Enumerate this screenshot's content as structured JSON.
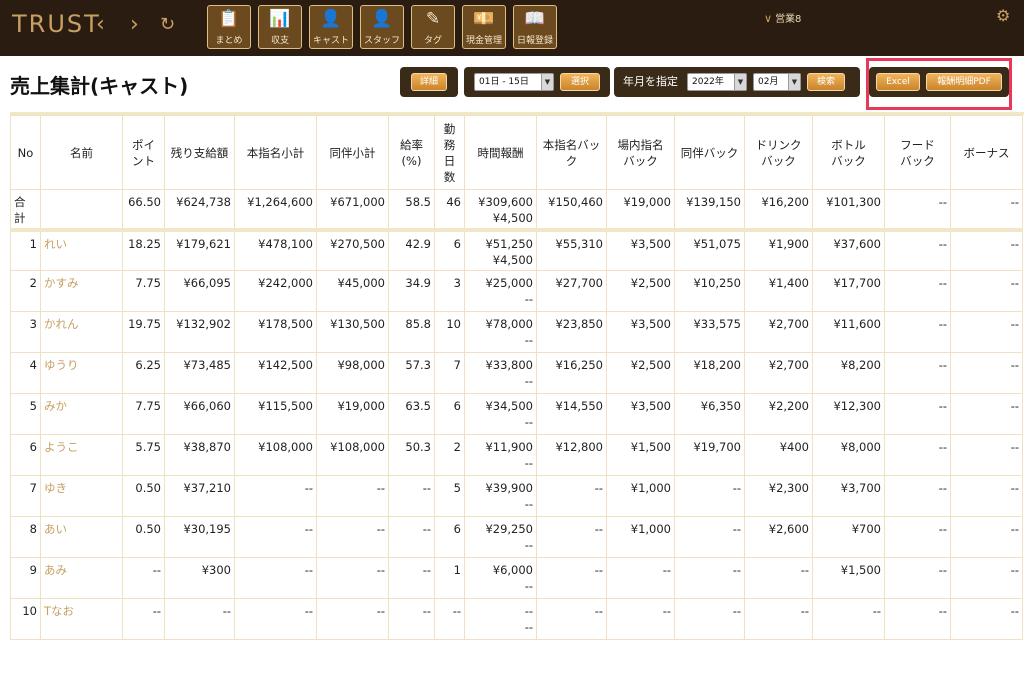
{
  "app": {
    "logo": "TRUST",
    "nav": {
      "back": "‹",
      "forward": "›",
      "refresh": "↻"
    },
    "tiles": [
      {
        "label": "まとめ",
        "icon": "📋"
      },
      {
        "label": "収支",
        "icon": "📊"
      },
      {
        "label": "キャスト",
        "icon": "👤"
      },
      {
        "label": "スタッフ",
        "icon": "👤"
      },
      {
        "label": "タグ",
        "icon": "✎"
      },
      {
        "label": "現金管理",
        "icon": "💴"
      },
      {
        "label": "日報登録",
        "icon": "📖"
      }
    ],
    "user": "営業8"
  },
  "page": {
    "title": "売上集計(キャスト)"
  },
  "controls": {
    "detail_button": "詳細",
    "period_value": "01日 - 15日",
    "select_button": "選択",
    "month_label": "年月を指定",
    "year_value": "2022年",
    "month_value": "02月",
    "search_button": "検索",
    "excel_button": "Excel",
    "pdf_button": "報酬明細PDF"
  },
  "table": {
    "headers": [
      "No",
      "名前",
      "ポイ\nント",
      "残り支給額",
      "本指名小計",
      "同伴小計",
      "給率\n(%)",
      "勤\n務\n日\n数",
      "時間報酬",
      "本指名バッ\nク",
      "場内指名\nバック",
      "同伴バック",
      "ドリンク\nバック",
      "ボトル\nバック",
      "フード\nバック",
      "ボーナス"
    ],
    "total": [
      "合\n計",
      "",
      "66.50",
      "¥624,738",
      "¥1,264,600",
      "¥671,000",
      "58.5",
      "46",
      "¥309,600\n¥4,500",
      "¥150,460",
      "¥19,000",
      "¥139,150",
      "¥16,200",
      "¥101,300",
      "--",
      "--"
    ],
    "rows": [
      [
        "1",
        "れい",
        "18.25",
        "¥179,621",
        "¥478,100",
        "¥270,500",
        "42.9",
        "6",
        "¥51,250\n¥4,500",
        "¥55,310",
        "¥3,500",
        "¥51,075",
        "¥1,900",
        "¥37,600",
        "--",
        "--"
      ],
      [
        "2",
        "かすみ",
        "7.75",
        "¥66,095",
        "¥242,000",
        "¥45,000",
        "34.9",
        "3",
        "¥25,000\n--",
        "¥27,700",
        "¥2,500",
        "¥10,250",
        "¥1,400",
        "¥17,700",
        "--",
        "--"
      ],
      [
        "3",
        "かれん",
        "19.75",
        "¥132,902",
        "¥178,500",
        "¥130,500",
        "85.8",
        "10",
        "¥78,000\n--",
        "¥23,850",
        "¥3,500",
        "¥33,575",
        "¥2,700",
        "¥11,600",
        "--",
        "--"
      ],
      [
        "4",
        "ゆうり",
        "6.25",
        "¥73,485",
        "¥142,500",
        "¥98,000",
        "57.3",
        "7",
        "¥33,800\n--",
        "¥16,250",
        "¥2,500",
        "¥18,200",
        "¥2,700",
        "¥8,200",
        "--",
        "--"
      ],
      [
        "5",
        "みか",
        "7.75",
        "¥66,060",
        "¥115,500",
        "¥19,000",
        "63.5",
        "6",
        "¥34,500\n--",
        "¥14,550",
        "¥3,500",
        "¥6,350",
        "¥2,200",
        "¥12,300",
        "--",
        "--"
      ],
      [
        "6",
        "ようこ",
        "5.75",
        "¥38,870",
        "¥108,000",
        "¥108,000",
        "50.3",
        "2",
        "¥11,900\n--",
        "¥12,800",
        "¥1,500",
        "¥19,700",
        "¥400",
        "¥8,000",
        "--",
        "--"
      ],
      [
        "7",
        "ゆき",
        "0.50",
        "¥37,210",
        "--",
        "--",
        "--",
        "5",
        "¥39,900\n--",
        "--",
        "¥1,000",
        "--",
        "¥2,300",
        "¥3,700",
        "--",
        "--"
      ],
      [
        "8",
        "あい",
        "0.50",
        "¥30,195",
        "--",
        "--",
        "--",
        "6",
        "¥29,250\n--",
        "--",
        "¥1,000",
        "--",
        "¥2,600",
        "¥700",
        "--",
        "--"
      ],
      [
        "9",
        "あみ",
        "--",
        "¥300",
        "--",
        "--",
        "--",
        "1",
        "¥6,000\n--",
        "--",
        "--",
        "--",
        "--",
        "¥1,500",
        "--",
        "--"
      ],
      [
        "10",
        "Tなお",
        "--",
        "--",
        "--",
        "--",
        "--",
        "--",
        "--\n--",
        "--",
        "--",
        "--",
        "--",
        "--",
        "--",
        "--"
      ]
    ]
  }
}
